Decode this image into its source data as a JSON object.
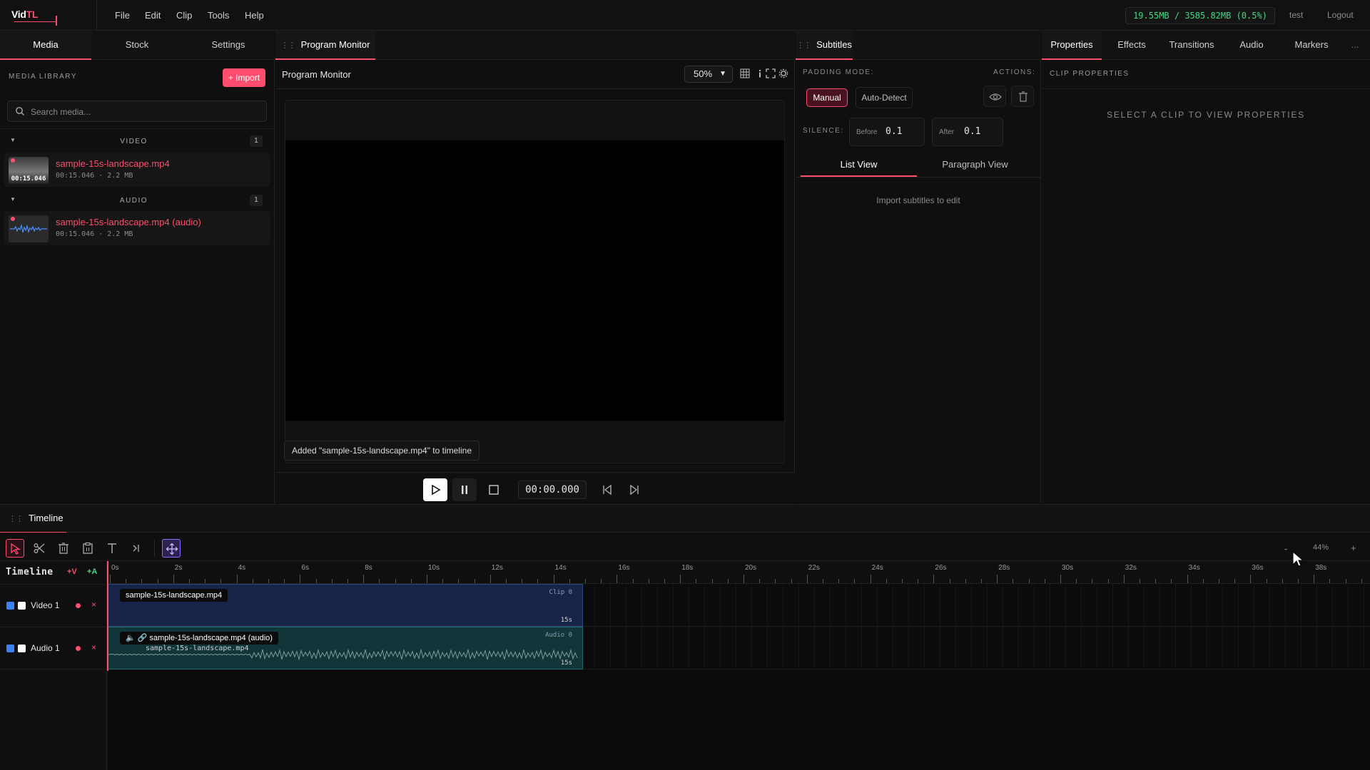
{
  "app": {
    "logo_left": "Vid",
    "logo_right": "TL"
  },
  "menu": [
    "File",
    "Edit",
    "Clip",
    "Tools",
    "Help"
  ],
  "memory": "19.55MB / 3585.82MB (0.5%)",
  "user": "test",
  "logout": "Logout",
  "left_tabs": [
    "Media",
    "Stock",
    "Settings"
  ],
  "media": {
    "header": "MEDIA LIBRARY",
    "import_label": "+ Import",
    "search_placeholder": "Search media...",
    "sections": [
      {
        "name": "VIDEO",
        "count": "1"
      },
      {
        "name": "AUDIO",
        "count": "1"
      }
    ],
    "video_item": {
      "name": "sample-15s-landscape.mp4",
      "meta": "00:15.046 · 2.2 MB",
      "thumb_dur": "00:15.046"
    },
    "audio_item": {
      "name": "sample-15s-landscape.mp4 (audio)",
      "meta": "00:15.046 · 2.2 MB"
    }
  },
  "monitor": {
    "tab": "Program Monitor",
    "title": "Program Monitor",
    "zoom": "50%",
    "toast": "Added \"sample-15s-landscape.mp4\" to timeline",
    "timecode": "00:00.000"
  },
  "subtitles": {
    "tab": "Subtitles",
    "padding_label": "PADDING MODE:",
    "actions_label": "ACTIONS:",
    "mode_manual": "Manual",
    "mode_auto": "Auto-Detect",
    "silence_label": "SILENCE:",
    "before_label": "Before",
    "before_value": "0.1",
    "after_label": "After",
    "after_value": "0.1",
    "view_tabs": [
      "List View",
      "Paragraph View"
    ],
    "empty": "Import subtitles to edit"
  },
  "right_tabs": [
    "Properties",
    "Effects",
    "Transitions",
    "Audio",
    "Markers"
  ],
  "right_more": "...",
  "properties": {
    "header": "CLIP PROPERTIES",
    "empty": "SELECT A CLIP TO VIEW PROPERTIES"
  },
  "timeline": {
    "tab": "Timeline",
    "title": "Timeline",
    "add_video": "+V",
    "add_audio": "+A",
    "zoom_minus": "-",
    "zoom": "44%",
    "zoom_plus": "+",
    "ruler": [
      "0s",
      "2s",
      "4s",
      "6s",
      "8s",
      "10s",
      "12s",
      "14s",
      "16s",
      "18s",
      "20s",
      "22s",
      "24s",
      "26s",
      "28s",
      "30s",
      "32s",
      "34s",
      "36s",
      "38s"
    ],
    "tracks": [
      {
        "name": "Video 1",
        "remove": "×"
      },
      {
        "name": "Audio 1",
        "remove": "×"
      }
    ],
    "video_clip": {
      "label": "sample-15s-landscape.mp4",
      "id": "Clip 0",
      "duration": "15s"
    },
    "audio_clip": {
      "label": "sample-15s-landscape.mp4 (audio)",
      "source": "sample-15s-landscape.mp4",
      "id": "Audio 0",
      "duration": "15s"
    }
  },
  "colors": {
    "accent": "#ff4d6d",
    "memory": "#3ddc84",
    "video_clip": "#17244a",
    "audio_clip": "#10363a"
  }
}
